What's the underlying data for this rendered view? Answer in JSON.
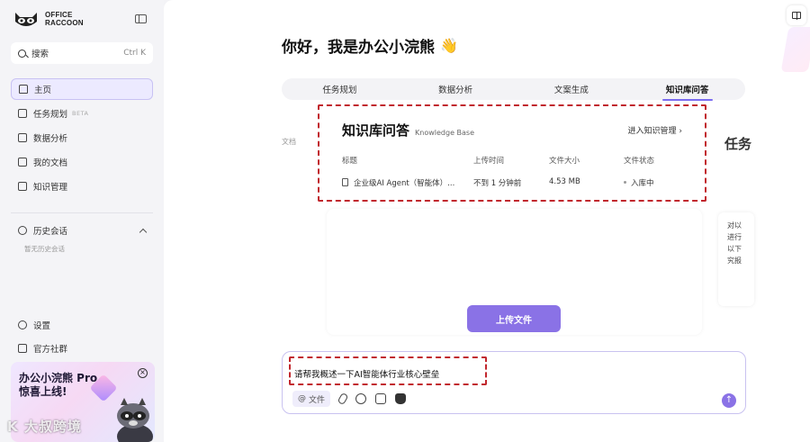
{
  "sidebar": {
    "brand_line1": "OFFICE",
    "brand_line2": "RACCOON",
    "search_label": "搜索",
    "search_shortcut": "Ctrl K",
    "nav": [
      {
        "label": "主页"
      },
      {
        "label": "任务规划",
        "badge": "BETA"
      },
      {
        "label": "数据分析"
      },
      {
        "label": "我的文档"
      },
      {
        "label": "知识管理"
      }
    ],
    "history_title": "历史会话",
    "history_empty": "暂无历史会话",
    "settings_label": "设置",
    "community_label": "官方社群",
    "promo_line1": "办公小浣熊 Pro",
    "promo_line2": "惊喜上线!",
    "watermark": "K 大叔跨境"
  },
  "main": {
    "greeting": "你好，我是办公小浣熊",
    "greeting_emoji": "👋",
    "tabs": [
      "任务规划",
      "数据分析",
      "文案生成",
      "知识库问答"
    ],
    "active_tab": "知识库问答",
    "side_label": "文档",
    "kb": {
      "title": "知识库问答",
      "subtitle": "Knowledge Base",
      "manage_link": "进入知识管理",
      "columns": [
        "标题",
        "上传时间",
        "文件大小",
        "文件状态"
      ],
      "rows": [
        {
          "title": "企业级AI Agent（智能体）...",
          "time": "不到 1 分钟前",
          "size": "4.53 MB",
          "status": "入库中"
        }
      ]
    },
    "upload_button": "上传文件",
    "right_title": "任务",
    "right_card_text": [
      "对以",
      "进行",
      "以下",
      "究报"
    ],
    "input_text": "请帮我概述一下AI智能体行业核心壁垒",
    "file_chip": "文件",
    "accent_color": "#8a72e6",
    "highlight_color": "#c1272d"
  }
}
